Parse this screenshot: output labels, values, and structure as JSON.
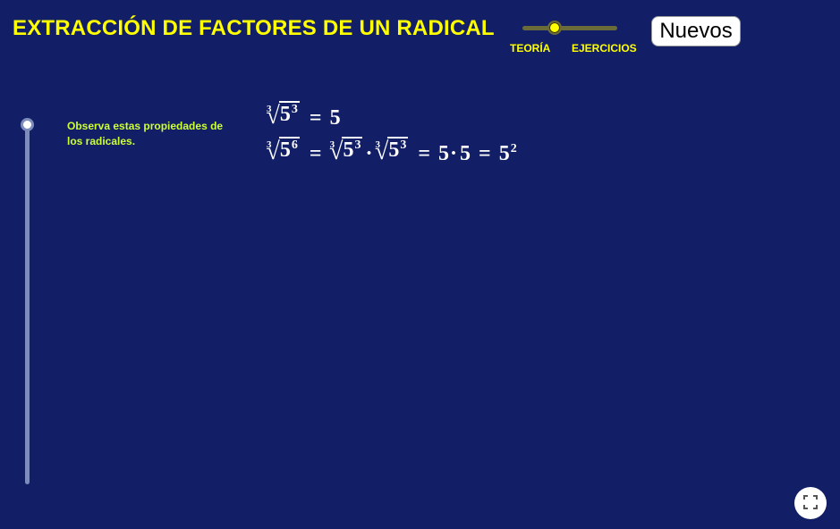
{
  "header": {
    "title": "EXTRACCIÓN DE FACTORES DE UN RADICAL"
  },
  "mode_slider": {
    "left_label": "TEORÍA",
    "right_label": "EJERCICIOS",
    "value": 0.3
  },
  "buttons": {
    "new_label": "Nuevos"
  },
  "step_slider": {
    "value": 0
  },
  "hint": {
    "text": "Observa estas propiedades de los radicales."
  },
  "math": {
    "line1": {
      "index": "3",
      "radicand_base": "5",
      "radicand_exp": "3",
      "equals": "=",
      "result": "5"
    },
    "line2": {
      "index": "3",
      "radicand_base": "5",
      "radicand_exp": "6",
      "equals": "=",
      "term1_index": "3",
      "term1_base": "5",
      "term1_exp": "3",
      "dot": "·",
      "term2_index": "3",
      "term2_base": "5",
      "term2_exp": "3",
      "step_a": "5",
      "step_b": "5",
      "final_base": "5",
      "final_exp": "2"
    }
  },
  "colors": {
    "background": "#121f66",
    "title": "#ffff00",
    "hint": "#ccff33",
    "math": "#ffffff"
  },
  "icons": {
    "fullscreen": "fullscreen-icon"
  }
}
